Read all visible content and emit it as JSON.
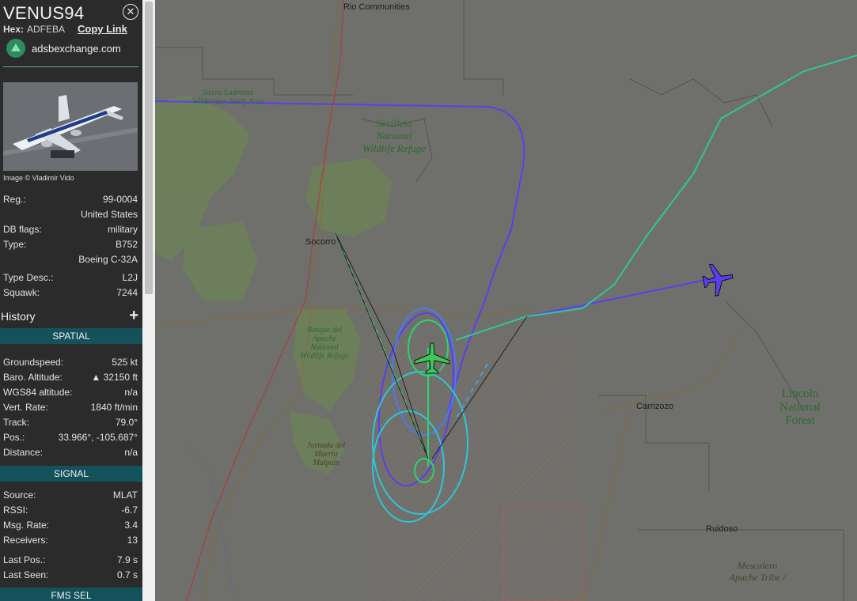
{
  "aircraft": {
    "callsign": "VENUS94",
    "hex_label": "Hex:",
    "hex": "ADFEBA",
    "copy_link": "Copy Link",
    "site": "adsbexchange.com",
    "photo_credit": "Image © Vladimir Vido"
  },
  "details": {
    "reg_label": "Reg.:",
    "reg": "99-0004",
    "country": "United States",
    "dbflags_label": "DB flags:",
    "dbflags": "military",
    "type_label": "Type:",
    "type": "B752",
    "model": "Boeing C-32A",
    "typedesc_label": "Type Desc.:",
    "typedesc": "L2J",
    "squawk_label": "Squawk:",
    "squawk": "7244"
  },
  "history": {
    "label": "History",
    "plus": "+"
  },
  "spatial": {
    "header": "SPATIAL",
    "groundspeed_label": "Groundspeed:",
    "groundspeed": "525 kt",
    "baro_label": "Baro. Altitude:",
    "baro": "▲ 32150 ft",
    "wgs_label": "WGS84 altitude:",
    "wgs": "n/a",
    "vrate_label": "Vert. Rate:",
    "vrate": "1840 ft/min",
    "track_label": "Track:",
    "track": "79.0°",
    "pos_label": "Pos.:",
    "pos": "33.966°, -105.687°",
    "distance_label": "Distance:",
    "distance": "n/a"
  },
  "signal": {
    "header": "SIGNAL",
    "source_label": "Source:",
    "source": "MLAT",
    "rssi_label": "RSSI:",
    "rssi": "-6.7",
    "msgrate_label": "Msg. Rate:",
    "msgrate": "3.4",
    "receivers_label": "Receivers:",
    "receivers": "13",
    "lastpos_label": "Last Pos.:",
    "lastpos": "7.9 s",
    "lastseen_label": "Last Seen:",
    "lastseen": "0.7 s"
  },
  "fms": {
    "header": "FMS SEL"
  },
  "map": {
    "rio": "Rio Communities",
    "sierra": "Sierra Ladrones Wilderness Study Area",
    "sevilleta": "Sevilleta National Wildlife Refuge",
    "socorro": "Socorro",
    "bosque": "Bosque del Apache National Wildlife Refuge",
    "jornada": "Jornada del Muerto Malpais",
    "carrizozo": "Carrizozo",
    "lincoln": "Lincoln National Forest",
    "ruidoso": "Ruidoso",
    "mescalero": "Mescalero Apache Tribe /",
    "colors": {
      "panel": "#2b2b2b",
      "band": "#14525b",
      "track_blue": "#5a3ff0",
      "track_green": "#2ed36a",
      "track_cyan": "#2ec5d8"
    }
  }
}
